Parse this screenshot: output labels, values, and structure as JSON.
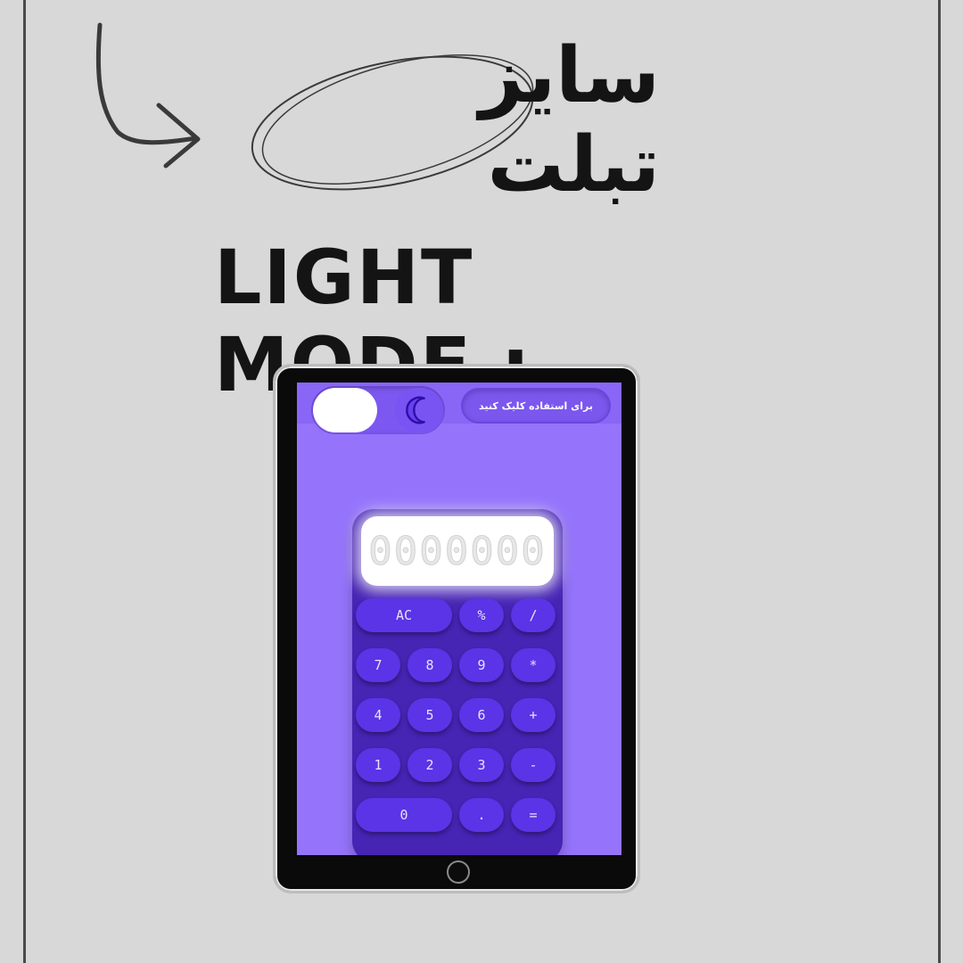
{
  "header": {
    "title_fa": "سایز تبلت",
    "mode_label": "LIGHT MODE :"
  },
  "tablet_app": {
    "use_hint": "برای استفاده کلیک کنید",
    "toggle_state": "light",
    "moon_icon": "moon-icon"
  },
  "calculator": {
    "display_value": "0000000",
    "keys": [
      {
        "label": "AC",
        "row": 0,
        "col": 0,
        "span": 2
      },
      {
        "label": "%",
        "row": 0,
        "col": 2,
        "span": 1
      },
      {
        "label": "/",
        "row": 0,
        "col": 3,
        "span": 1
      },
      {
        "label": "7",
        "row": 1,
        "col": 0,
        "span": 1
      },
      {
        "label": "8",
        "row": 1,
        "col": 1,
        "span": 1
      },
      {
        "label": "9",
        "row": 1,
        "col": 2,
        "span": 1
      },
      {
        "label": "*",
        "row": 1,
        "col": 3,
        "span": 1
      },
      {
        "label": "4",
        "row": 2,
        "col": 0,
        "span": 1
      },
      {
        "label": "5",
        "row": 2,
        "col": 1,
        "span": 1
      },
      {
        "label": "6",
        "row": 2,
        "col": 2,
        "span": 1
      },
      {
        "label": "+",
        "row": 2,
        "col": 3,
        "span": 1
      },
      {
        "label": "1",
        "row": 3,
        "col": 0,
        "span": 1
      },
      {
        "label": "2",
        "row": 3,
        "col": 1,
        "span": 1
      },
      {
        "label": "3",
        "row": 3,
        "col": 2,
        "span": 1
      },
      {
        "label": "-",
        "row": 3,
        "col": 3,
        "span": 1
      },
      {
        "label": "0",
        "row": 4,
        "col": 0,
        "span": 2
      },
      {
        "label": ".",
        "row": 4,
        "col": 2,
        "span": 1
      },
      {
        "label": "=",
        "row": 4,
        "col": 3,
        "span": 1
      }
    ]
  },
  "colors": {
    "background": "#d8d8d8",
    "screen": "#9574fb",
    "calculator_body": "#4624b4",
    "key": "#5a34e6",
    "display": "#ffffff"
  }
}
